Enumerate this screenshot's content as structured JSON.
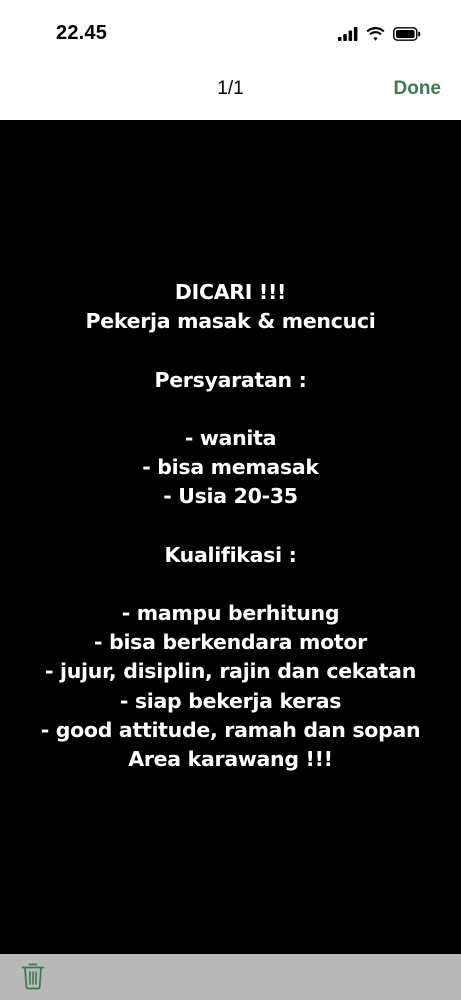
{
  "status_bar": {
    "time": "22.45",
    "icons": [
      "cellular-signal-icon",
      "wifi-icon",
      "battery-icon"
    ]
  },
  "nav": {
    "page_counter": "1/1",
    "done_label": "Done",
    "accent_color": "#3d7a57"
  },
  "image_content": {
    "background_color": "#000000",
    "text_color": "#ffffff",
    "lines": [
      "DICARI !!!",
      "Pekerja masak & mencuci",
      "",
      "Persyaratan :",
      "",
      "- wanita",
      "- bisa memasak",
      "- Usia 20-35",
      "",
      "Kualifikasi :",
      "",
      "- mampu berhitung",
      "- bisa berkendara motor",
      "- jujur, disiplin, rajin dan cekatan",
      "- siap bekerja keras",
      "- good attitude, ramah dan sopan",
      "Area karawang !!!"
    ]
  },
  "toolbar": {
    "icons": [
      "trash-icon"
    ],
    "background_color": "#b9b9b9"
  }
}
